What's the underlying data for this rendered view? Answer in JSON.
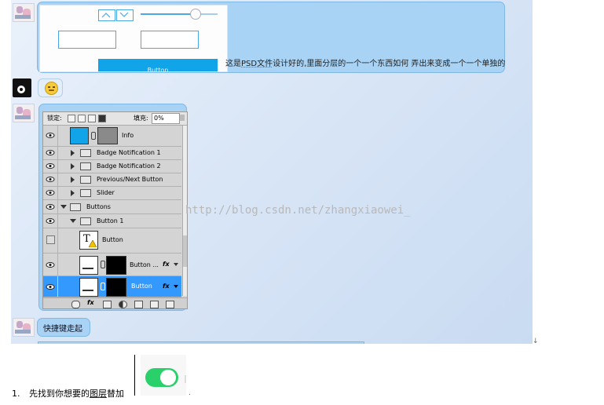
{
  "chat": {
    "message1_text_a": "这是",
    "message1_text_psd": "PSD文件",
    "message1_text_b": "设计好的,里面分层的一个一个东西如何 弄出来变成一个一个单独的",
    "mock_button_label": "Button",
    "message4_text": "快捷键走起"
  },
  "ps_panel": {
    "lock_label": "锁定:",
    "fill_label": "填充:",
    "fill_value": "0%",
    "layers": [
      {
        "name": "Info"
      },
      {
        "name": "Badge Notification 1"
      },
      {
        "name": "Badge Notification 2"
      },
      {
        "name": "Previous/Next Button"
      },
      {
        "name": "Slider"
      },
      {
        "name": "Buttons"
      },
      {
        "name": "Button 1"
      },
      {
        "name": "Button"
      },
      {
        "name": "Button ..."
      },
      {
        "name": "Button"
      }
    ],
    "fx_label": "fx"
  },
  "watermark": "http://blog.csdn.net/zhangxiaowei_",
  "doc": {
    "list_number": "1.",
    "list_text_a": "先找到你想要的",
    "list_text_b": "图层",
    "list_text_c": "替加",
    "tiny_arrow": "↓",
    "trail_dot": "."
  },
  "colors": {
    "bubble": "#a9d3f4",
    "selection": "#3399ff",
    "toggle_on": "#2ad06a"
  }
}
